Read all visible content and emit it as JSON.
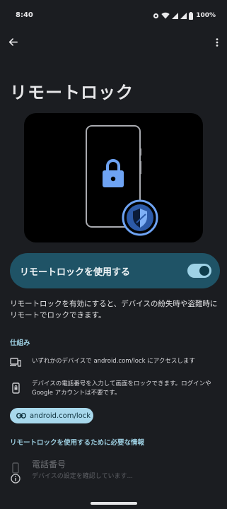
{
  "status_bar": {
    "time": "8:40",
    "battery": "100%",
    "icons": [
      "privacy-dot-icon",
      "wifi-icon",
      "signal-icon",
      "signal-icon",
      "battery-icon"
    ]
  },
  "app_bar": {
    "back_icon": "arrow-back-icon",
    "more_icon": "more-vert-icon"
  },
  "page": {
    "title": "リモートロック"
  },
  "hero": {
    "illustration": "phone-with-lock-and-shield",
    "icons": [
      "lock-icon",
      "shield-icon"
    ]
  },
  "toggle": {
    "label": "リモートロックを使用する",
    "checked": true
  },
  "description": "リモートロックを有効にすると、デバイスの紛失時や盗難時にリモートでロックできます。",
  "how_it_works": {
    "heading": "仕組み",
    "items": [
      {
        "icon": "devices-icon",
        "text": "いずれかのデバイスで android.com/lock にアクセスします"
      },
      {
        "icon": "phone-lock-icon",
        "text": "デバイスの電話番号を入力して画面をロックできます。ログインやGoogle アカウントは不要です。"
      }
    ],
    "chip_icon": "link-icon",
    "chip_label": "android.com/lock"
  },
  "required_info": {
    "heading": "リモートロックを使用するために必要な情報",
    "phone_title": "電話番号",
    "phone_subtitle": "デバイスの設定を確認しています...",
    "phone_icon": "smartphone-icon",
    "info_icon": "info-icon"
  },
  "colors": {
    "background": "#1b1d21",
    "accent": "#9ccee0",
    "toggle_card": "#1f5366",
    "chip": "#a8d8ec",
    "lock": "#6ea3f3",
    "shield": "#2c5aa8"
  }
}
